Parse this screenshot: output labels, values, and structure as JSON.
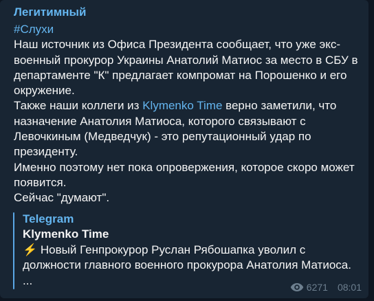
{
  "channel": {
    "name": "Легитимный"
  },
  "message": {
    "hashtag": "#Слухи",
    "lines": [
      "Наш источник из Офиса Президента сообщает, что уже экс-",
      "военный прокурор Украины Анатолий Матиос за место в СБУ в",
      "департаменте \"К\" предлагает компромат на Порошенко и его",
      "окружение."
    ],
    "line5_prefix": "Также наши коллеги из ",
    "line5_mention": "Klymenko Time",
    "line5_suffix": " верно заметили, что",
    "lines2": [
      "назначение Анатолия Матиоса, которого связывают с",
      "Левочкиным (Медведчук) - это репутационный удар по",
      "президенту.",
      "Именно поэтому нет пока опровержения, которое скоро может",
      "появится.",
      "Сейчас \"думают\"."
    ]
  },
  "forward": {
    "source": "Telegram",
    "author": "Klymenko Time",
    "bolt": "⚡",
    "line1": " Новый Генпрокурор Руслан Рябошапка уволил с",
    "line2": "должности главного военного прокурора Анатолия Матиоса.",
    "line3": "..."
  },
  "meta": {
    "views": "6271",
    "time": "08:01",
    "icon": "eye-icon"
  },
  "colors": {
    "background": "#0e1621",
    "bubble": "#182533",
    "accent": "#64b5ef",
    "text": "#f5f5f5",
    "meta": "#6d7f8f"
  }
}
